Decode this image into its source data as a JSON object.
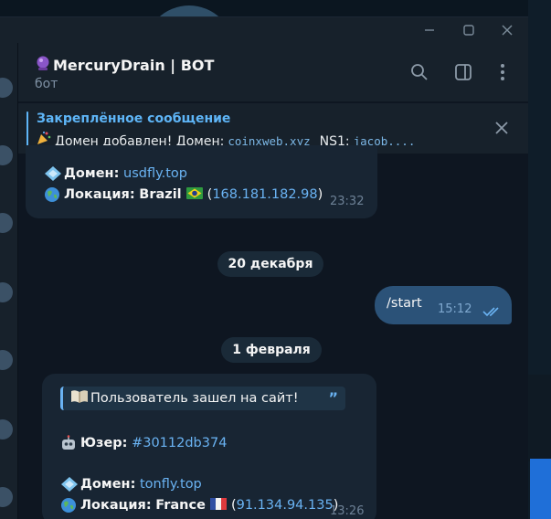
{
  "window": {
    "title": "MercuryDrain | BOT",
    "title_icon": "crystal-ball-icon",
    "subtitle": "бот"
  },
  "pinned": {
    "title": "Закреплённое сообщение",
    "prefix": "Домен добавлен!  Домен:",
    "domain": "coinxweb.xyz",
    "ns_label": "NS1:",
    "ns_value": "jacob...."
  },
  "messages": {
    "m1": {
      "domain_label": "Домен:",
      "domain": "usdfly.top",
      "location_label": "Локация:",
      "location": "Brazil",
      "ip_open": "(",
      "ip": "168.181.182.98",
      "ip_close": ")",
      "time": "23:32"
    },
    "date1": "20 декабря",
    "out": {
      "text": "/start",
      "time": "15:12"
    },
    "date2": "1 февраля",
    "m2": {
      "quote": "Пользователь зашел на сайт!",
      "user_label": "Юзер:",
      "user": "#30112db374",
      "domain_label": "Домен:",
      "domain": "tonfly.top",
      "location_label": "Локация:",
      "location": "France",
      "ip_open": "(",
      "ip": "91.134.94.135",
      "ip_close": ")",
      "time": "13:26"
    }
  },
  "colors": {
    "accent": "#5eb5f7",
    "link": "#6ab3f3",
    "bubble_in": "#182533",
    "bubble_out": "#2b5278",
    "background": "#0e1621"
  }
}
